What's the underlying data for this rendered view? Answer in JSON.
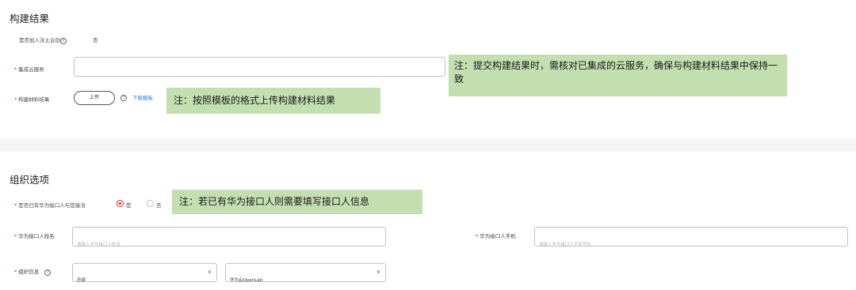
{
  "build_result": {
    "title": "构建结果",
    "join_label": "是否加入沃土云创",
    "join_value": "否",
    "integrated_label": "集成云服务",
    "integrated_value": "",
    "material_label": "构建材料结果",
    "upload_label": "上传",
    "download_template": "下载模板",
    "note_submit": "注：提交构建结果时，需核对已集成的云服务，确保与构建材料结果中保持一致",
    "note_upload": "注：按照模板的格式上传构建材料结果"
  },
  "org_options": {
    "title": "组织选项",
    "contact_question": "是否已有华为接口人与您接洽",
    "yes_label": "是",
    "no_label": "否",
    "selected": "是",
    "note_contact": "注：若已有华为接口人则需要填写接口人信息",
    "name_label": "华为接口人姓名",
    "name_placeholder": "请输入华为接口人姓名",
    "phone_label": "华为接口人手机",
    "phone_placeholder": "请输入华为接口人手机号码",
    "org_label": "组织信息",
    "org_select1": "总部",
    "org_select2": "华为云OpenLab"
  },
  "colors": {
    "note_bg": "#c3dfaf",
    "required": "#e02020",
    "link": "#3b7ee0"
  },
  "icons": [
    "help-icon",
    "chevron-down-icon",
    "radio-icon"
  ]
}
